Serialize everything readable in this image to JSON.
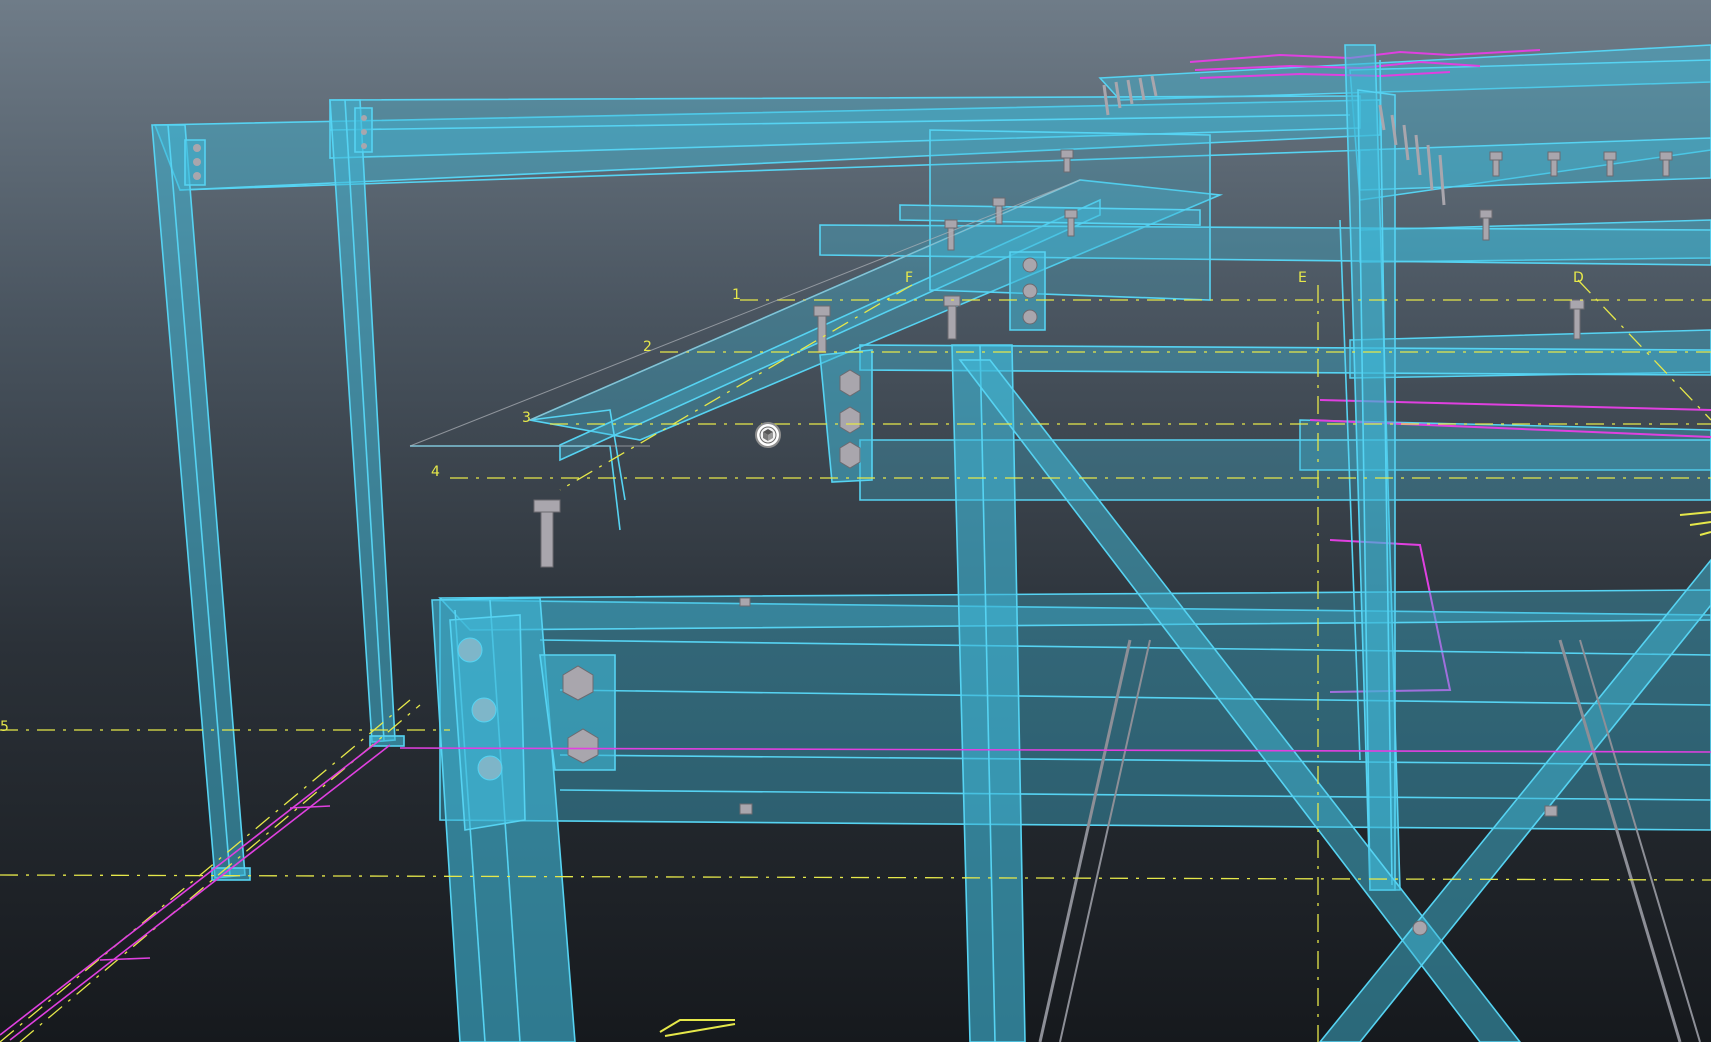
{
  "viewport": {
    "colors": {
      "steel_fill": "#3fb7d6",
      "steel_edge": "#56d3f2",
      "grid_line": "#e6e84a",
      "markup_line": "#e040e0",
      "bolt": "#a9a6ad",
      "background_top": "#6f7c88",
      "background_bottom": "#16191d"
    },
    "grid_labels": {
      "row_1": "1",
      "row_2": "2",
      "row_3": "3",
      "row_4": "4",
      "row_5": "5",
      "col_f": "F",
      "col_e": "E",
      "col_d": "D"
    },
    "pivot_icon": "orbit-pivot-icon"
  }
}
